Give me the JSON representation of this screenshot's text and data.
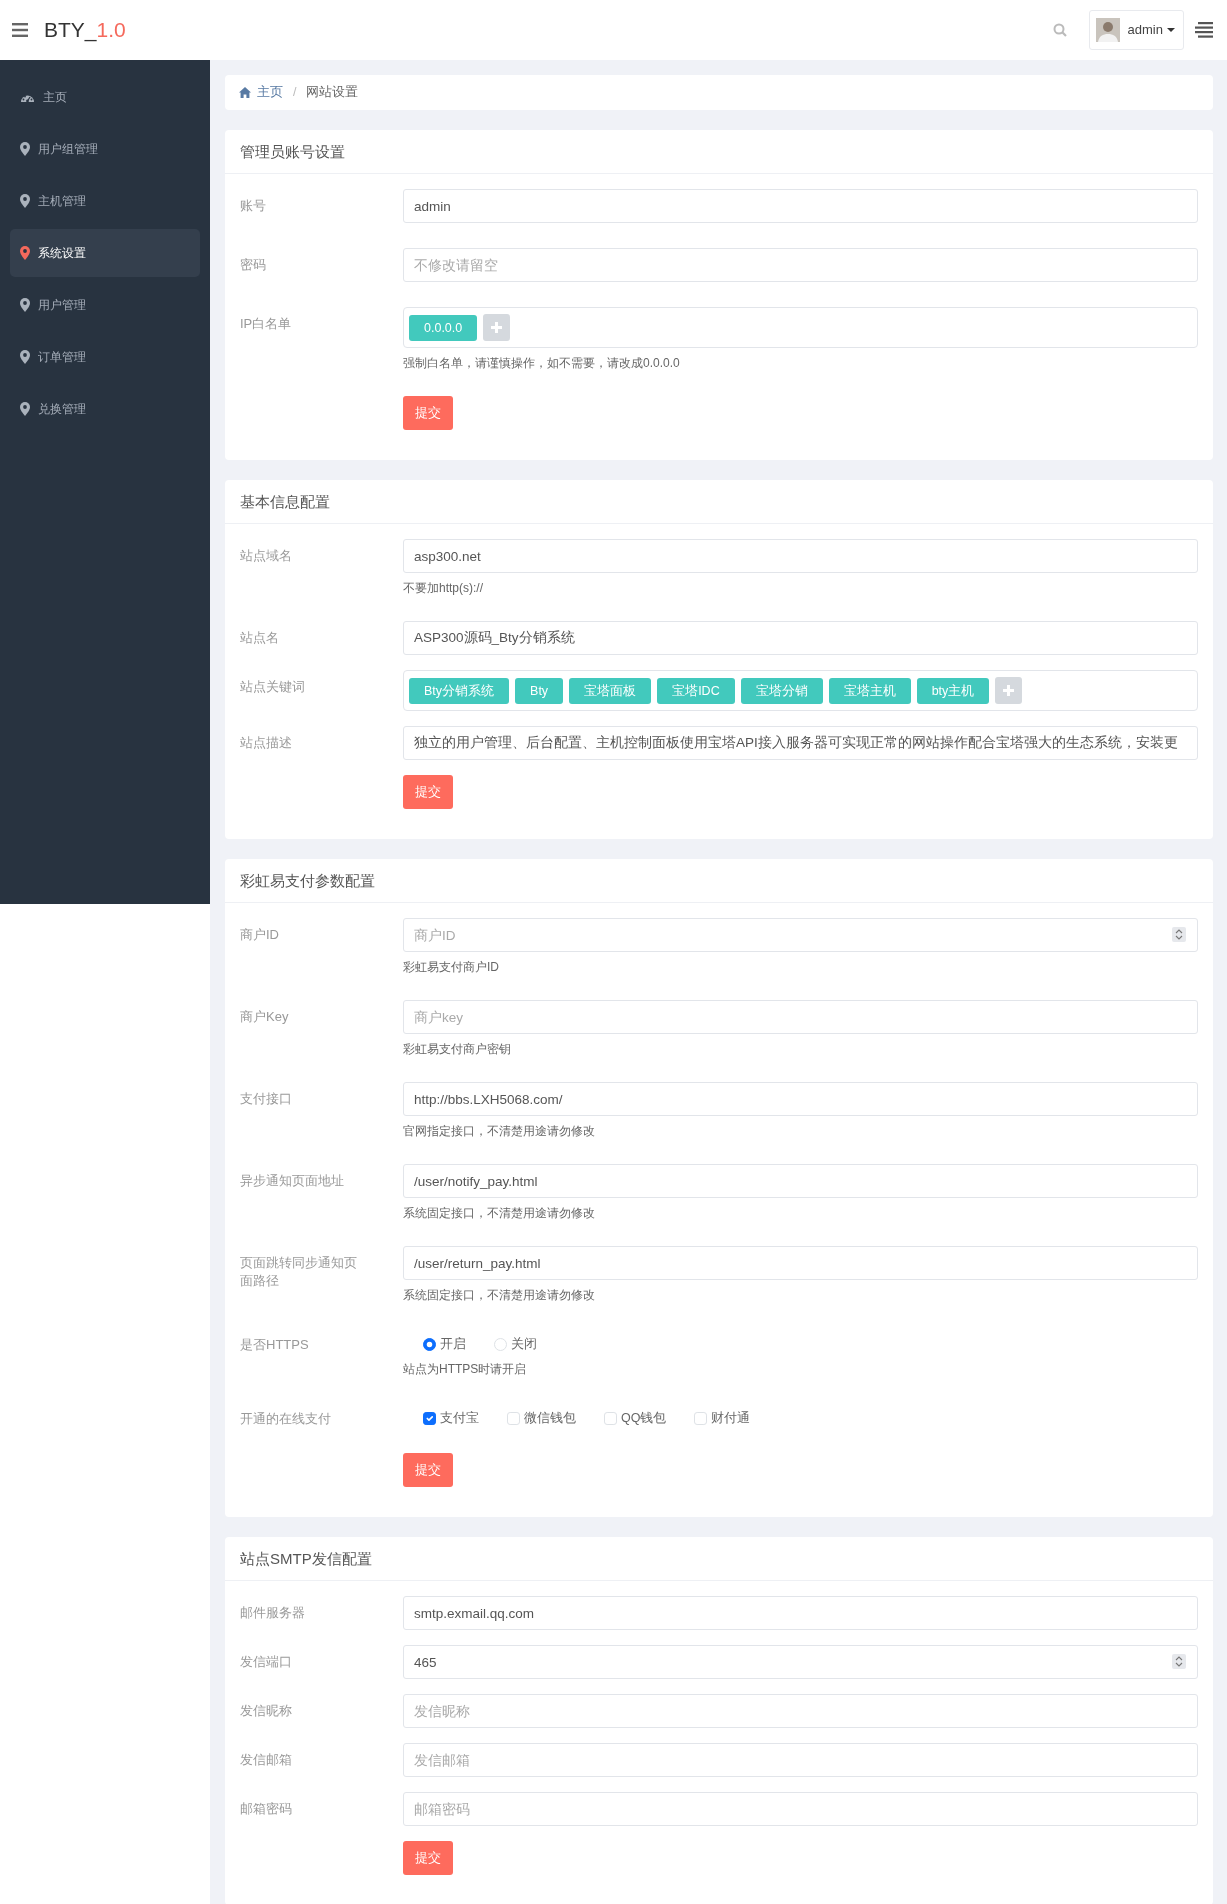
{
  "navbar": {
    "brand": "BTY_",
    "version": "1.0",
    "user": "admin"
  },
  "sidebar": {
    "items": [
      {
        "label": "主页",
        "selected": false
      },
      {
        "label": "用户组管理",
        "selected": false
      },
      {
        "label": "主机管理",
        "selected": false
      },
      {
        "label": "系统设置",
        "selected": true
      },
      {
        "label": "用户管理",
        "selected": false
      },
      {
        "label": "订单管理",
        "selected": false
      },
      {
        "label": "兑换管理",
        "selected": false
      }
    ]
  },
  "breadcrumb": {
    "separator": "/",
    "items": [
      {
        "label": "主页"
      },
      {
        "label": "网站设置"
      }
    ]
  },
  "sections": [
    {
      "title": "管理员账号设置",
      "submit": "提交",
      "fields": [
        {
          "kind": "text",
          "label": "账号",
          "value": "admin"
        },
        {
          "kind": "text",
          "label": "密码",
          "placeholder": "不修改请留空"
        },
        {
          "kind": "tags",
          "label": "IP白名单",
          "tags": [
            "0.0.0.0"
          ],
          "help": "强制白名单，请谨慎操作，如不需要，请改成0.0.0.0"
        }
      ]
    },
    {
      "title": "基本信息配置",
      "submit": "提交",
      "fields": [
        {
          "kind": "text",
          "label": "站点域名",
          "value": "asp300.net",
          "help": "不要加http(s)://"
        },
        {
          "kind": "text",
          "label": "站点名",
          "value": "ASP300源码_Bty分销系统"
        },
        {
          "kind": "tags",
          "label": "站点关键词",
          "tags": [
            "Bty分销系统",
            "Bty",
            "宝塔面板",
            "宝塔IDC",
            "宝塔分销",
            "宝塔主机",
            "bty主机"
          ]
        },
        {
          "kind": "text",
          "label": "站点描述",
          "value": "独立的用户管理、后台配置、主机控制面板使用宝塔API接入服务器可实现正常的网站操作配合宝塔强大的生态系统，安装更"
        }
      ]
    },
    {
      "title": "彩虹易支付参数配置",
      "submit": "提交",
      "fields": [
        {
          "kind": "number",
          "label": "商户ID",
          "placeholder": "商户ID",
          "help": "彩虹易支付商户ID"
        },
        {
          "kind": "text",
          "label": "商户Key",
          "placeholder": "商户key",
          "help": "彩虹易支付商户密钥"
        },
        {
          "kind": "text",
          "label": "支付接口",
          "value": "http://bbs.LXH5068.com/",
          "help": "官网指定接口，不清楚用途请勿修改"
        },
        {
          "kind": "text",
          "label": "异步通知页面地址",
          "value": "/user/notify_pay.html",
          "help": "系统固定接口，不清楚用途请勿修改"
        },
        {
          "kind": "text",
          "label": "页面跳转同步通知页面路径",
          "value": "/user/return_pay.html",
          "help": "系统固定接口，不清楚用途请勿修改"
        },
        {
          "kind": "radio",
          "label": "是否HTTPS",
          "options": [
            {
              "label": "开启",
              "selected": true
            },
            {
              "label": "关闭",
              "selected": false
            }
          ],
          "help": "站点为HTTPS时请开启"
        },
        {
          "kind": "checkbox",
          "label": "开通的在线支付",
          "options": [
            {
              "label": "支付宝",
              "checked": true
            },
            {
              "label": "微信钱包",
              "checked": false
            },
            {
              "label": "QQ钱包",
              "checked": false
            },
            {
              "label": "财付通",
              "checked": false
            }
          ]
        }
      ]
    },
    {
      "title": "站点SMTP发信配置",
      "submit": "提交",
      "fields": [
        {
          "kind": "text",
          "label": "邮件服务器",
          "value": "smtp.exmail.qq.com"
        },
        {
          "kind": "number",
          "label": "发信端口",
          "value": "465"
        },
        {
          "kind": "text",
          "label": "发信昵称",
          "placeholder": "发信昵称"
        },
        {
          "kind": "text",
          "label": "发信邮箱",
          "placeholder": "发信邮箱"
        },
        {
          "kind": "text",
          "label": "邮箱密码",
          "placeholder": "邮箱密码"
        }
      ]
    }
  ]
}
